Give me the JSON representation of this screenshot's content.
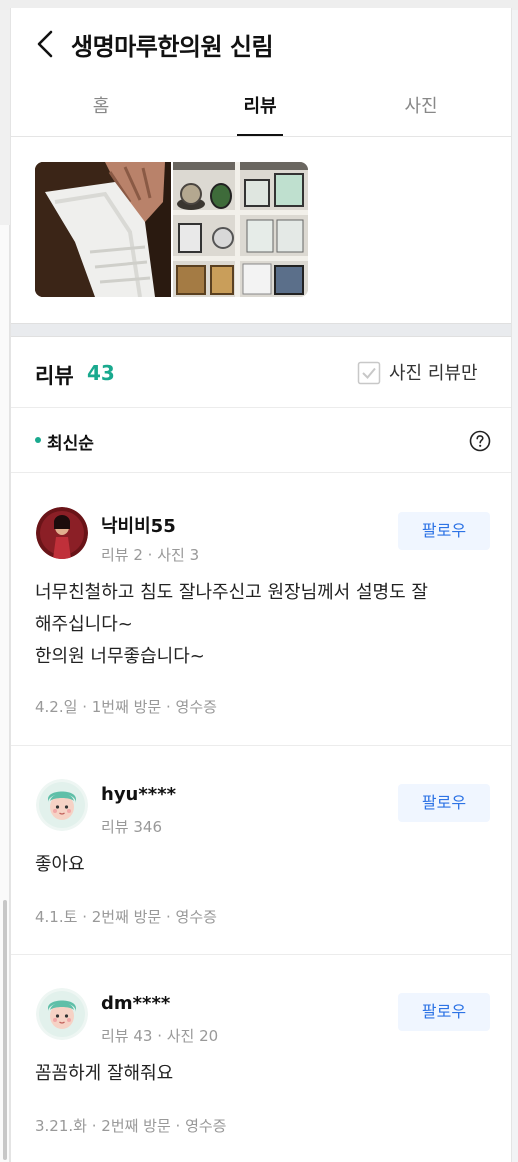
{
  "header": {
    "title": "생명마루한의원 신림",
    "back_icon": "chevron-left-icon"
  },
  "tabs": [
    {
      "label": "홈",
      "active": false
    },
    {
      "label": "리뷰",
      "active": true
    },
    {
      "label": "사진",
      "active": false
    }
  ],
  "reviews_header": {
    "title": "리뷰",
    "count": "43",
    "photo_only_label": "사진 리뷰만",
    "sort_label": "최신순"
  },
  "reviews": [
    {
      "nickname": "낙비비55",
      "stats": "리뷰 2 · 사진 3",
      "follow_label": "팔로우",
      "lines": [
        "너무친철하고 침도 잘나주신고 원장님께서 설명도 잘",
        "해주십니다~",
        "한의원 너무좋습니다~"
      ],
      "visit": "4.2.일 · 1번째 방문 · 영수증"
    },
    {
      "nickname": "hyu****",
      "stats": "리뷰 346",
      "follow_label": "팔로우",
      "lines": [
        "좋아요"
      ],
      "visit": "4.1.토 · 2번째 방문 · 영수증"
    },
    {
      "nickname": "dm****",
      "stats": "리뷰 43 · 사진 20",
      "follow_label": "팔로우",
      "lines": [
        "꼼꼼하게 잘해줘요"
      ],
      "visit": "3.21.화 · 2번째 방문 · 영수증"
    }
  ],
  "colors": {
    "accent": "#19a98e",
    "follow_text": "#2d73e5",
    "follow_bg": "#f0f6ff"
  }
}
